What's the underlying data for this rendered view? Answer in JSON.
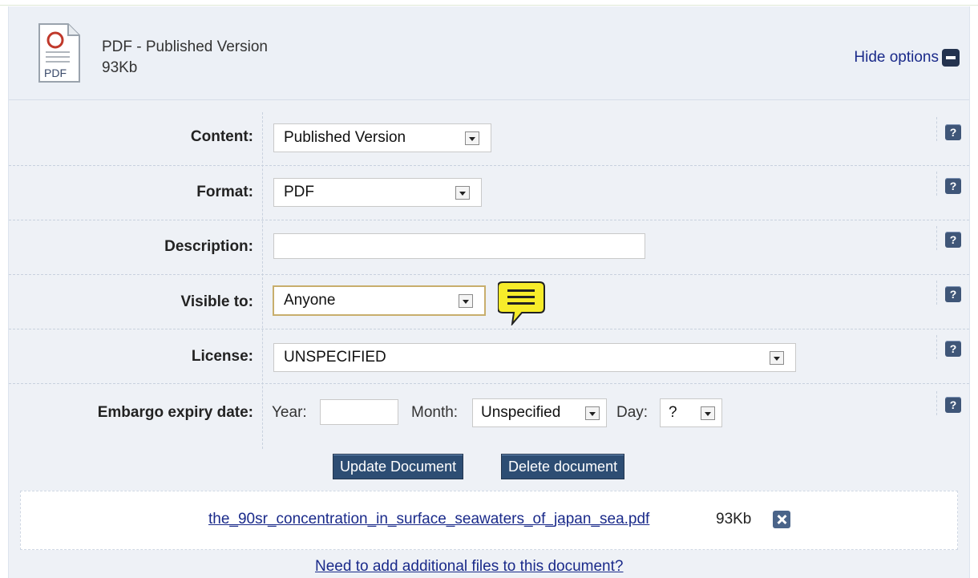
{
  "document": {
    "title": "PDF - Published Version",
    "size": "93Kb",
    "icon_label": "PDF",
    "hide_options": "Hide options"
  },
  "form": {
    "content_label": "Content:",
    "content_value": "Published Version",
    "format_label": "Format:",
    "format_value": "PDF",
    "description_label": "Description:",
    "description_value": "",
    "visible_label": "Visible to:",
    "visible_value": "Anyone",
    "license_label": "License:",
    "license_value": "UNSPECIFIED",
    "embargo_label": "Embargo expiry date:",
    "year_label": "Year:",
    "year_value": "",
    "month_label": "Month:",
    "month_value": "Unspecified",
    "day_label": "Day:",
    "day_value": "?"
  },
  "actions": {
    "update": "Update Document",
    "delete": "Delete document"
  },
  "file": {
    "name": "the_90sr_concentration_in_surface_seawaters_of_japan_sea.pdf",
    "size": "93Kb"
  },
  "add_files_link": "Need to add additional files to this document?",
  "help_symbol": "?"
}
